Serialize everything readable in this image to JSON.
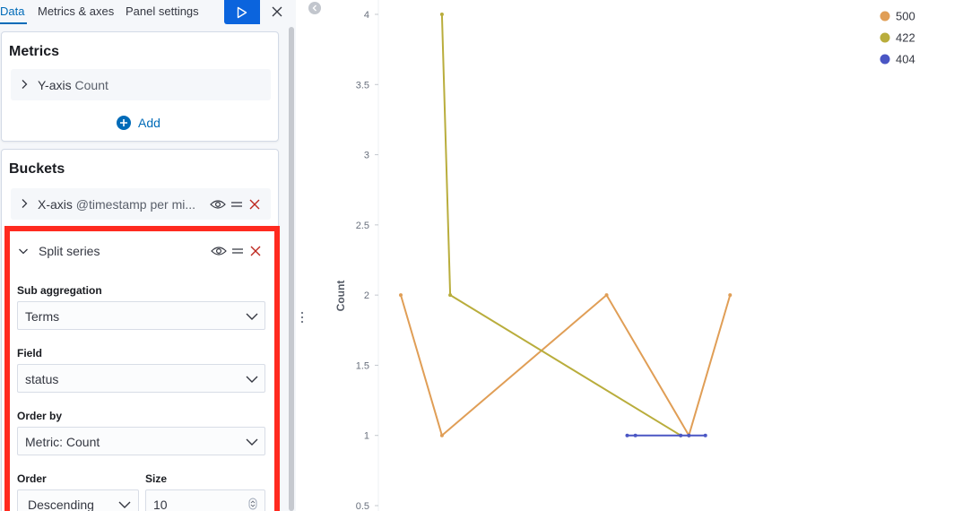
{
  "tabs": [
    {
      "label": "Data",
      "active": true
    },
    {
      "label": "Metrics & axes",
      "active": false
    },
    {
      "label": "Panel settings",
      "active": false
    }
  ],
  "metrics": {
    "title": "Metrics",
    "items": [
      {
        "axis": "Y-axis",
        "label": "Count"
      }
    ],
    "add_label": "Add"
  },
  "buckets": {
    "title": "Buckets",
    "x_axis": {
      "axis": "X-axis",
      "label": "@timestamp per mi..."
    },
    "split": {
      "title": "Split series",
      "sub_aggregation": {
        "label": "Sub aggregation",
        "value": "Terms"
      },
      "field": {
        "label": "Field",
        "value": "status"
      },
      "order_by": {
        "label": "Order by",
        "value": "Metric: Count"
      },
      "order": {
        "label": "Order",
        "value": "Descending"
      },
      "size": {
        "label": "Size",
        "value": "10"
      }
    }
  },
  "colors": {
    "accent": "#006bb8",
    "apply_button": "#0b64dd",
    "highlight_border": "#ff2a1f",
    "danger": "#bd271e"
  },
  "chart_data": {
    "type": "line",
    "ylabel": "Count",
    "yticks": [
      0.5,
      1,
      1.5,
      2,
      2.5,
      3,
      3.5,
      4
    ],
    "ytick_labels": [
      "0.5",
      "1",
      "1.5",
      "2",
      "2.5",
      "3",
      "3.5",
      "4"
    ],
    "ylim": [
      0.5,
      4
    ],
    "x_index_range": [
      0,
      16
    ],
    "legend_position": "top-right",
    "series": [
      {
        "name": "500",
        "color": "#e09e56",
        "points": [
          [
            0,
            2
          ],
          [
            1,
            1
          ],
          [
            5,
            2
          ],
          [
            7,
            1
          ],
          [
            8,
            2
          ]
        ]
      },
      {
        "name": "422",
        "color": "#b9ad3c",
        "points": [
          [
            1,
            4
          ],
          [
            1.2,
            2
          ],
          [
            6.8,
            1
          ]
        ]
      },
      {
        "name": "404",
        "color": "#4a56c4",
        "points": [
          [
            5.5,
            1
          ],
          [
            5.7,
            1
          ],
          [
            6.8,
            1
          ],
          [
            7,
            1
          ],
          [
            7.4,
            1
          ]
        ]
      }
    ]
  }
}
